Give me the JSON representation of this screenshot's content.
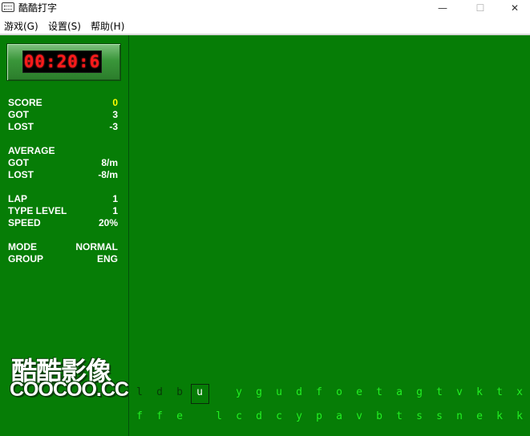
{
  "window": {
    "title": "酷酷打字",
    "min_icon": "minimize-icon",
    "max_icon": "maximize-icon",
    "close_icon": "close-icon"
  },
  "menu": [
    {
      "label": "游戏(G)"
    },
    {
      "label": "设置(S)"
    },
    {
      "label": "帮助(H)"
    }
  ],
  "timer": {
    "display": "00:20:6"
  },
  "stats": {
    "score_label": "SCORE",
    "score_value": "0",
    "got_label": "GOT",
    "got_value": "3",
    "lost_label": "LOST",
    "lost_value": "-3",
    "average_label": "AVERAGE",
    "avg_got_label": "GOT",
    "avg_got_value": "8/m",
    "avg_lost_label": "LOST",
    "avg_lost_value": "-8/m",
    "lap_label": "LAP",
    "lap_value": "1",
    "type_level_label": "TYPE LEVEL",
    "type_level_value": "1",
    "speed_label": "SPEED",
    "speed_value": "20%",
    "mode_label": "MODE",
    "mode_value": "NORMAL",
    "group_label": "GROUP",
    "group_value": "ENG"
  },
  "logo": {
    "cn": "酷酷影像",
    "en": "COOCOO.CC"
  },
  "row1": {
    "typed": [
      "l",
      "d",
      "b"
    ],
    "current": "u",
    "pending": [
      "y",
      "g",
      "u",
      "d",
      "f",
      "o",
      "e",
      "t",
      "a",
      "g",
      "t",
      "v",
      "k",
      "t",
      "x"
    ]
  },
  "row2": {
    "left": [
      "f",
      "f",
      "e"
    ],
    "right": [
      "l",
      "c",
      "d",
      "c",
      "y",
      "p",
      "a",
      "v",
      "b",
      "t",
      "s",
      "s",
      "n",
      "e",
      "k",
      "k"
    ]
  },
  "colors": {
    "background": "#067d06",
    "typed": "#083a08",
    "pending": "#22f022",
    "score_value": "#ffff00",
    "timer_digits": "#ff1a1a"
  }
}
